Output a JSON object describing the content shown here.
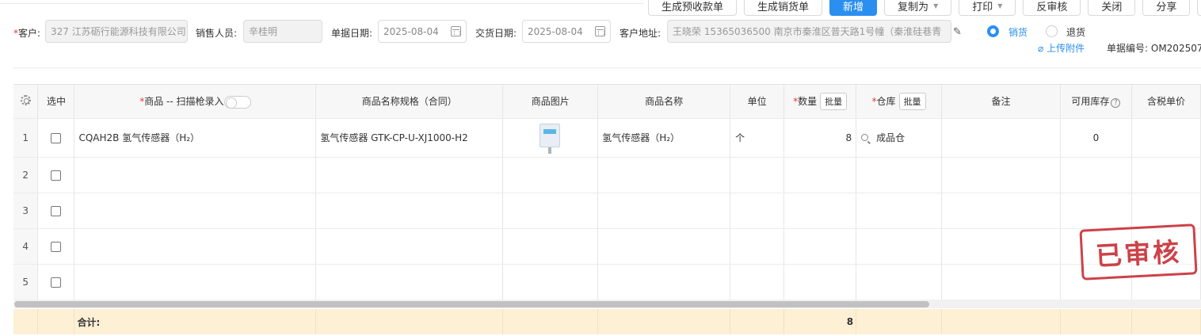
{
  "toolbar": {
    "gen_prepay_label": "生成预收款单",
    "gen_sales_label": "生成销货单",
    "new_label": "新增",
    "copy_label": "复制为",
    "print_label": "打印",
    "unaudit_label": "反审核",
    "close_label": "关闭",
    "share_label": "分享"
  },
  "form": {
    "customer_label": "客户:",
    "customer_value": "327 江苏砺行能源科技有限公司",
    "salesperson_label": "销售人员:",
    "salesperson_value": "辛桂明",
    "doc_date_label": "单据日期:",
    "doc_date_value": "2025-08-04",
    "delivery_date_label": "交货日期:",
    "delivery_date_value": "2025-08-04",
    "address_label": "客户地址:",
    "address_value": "王晓荣 15365036500 南京市秦淮区普天路1号幢（秦淮硅巷青",
    "radio_sale": "销货",
    "radio_return": "退货",
    "radio_selected": "sale",
    "upload_label": "上传附件",
    "doc_no_label": "单据编号:",
    "doc_no_value": "OM202507"
  },
  "table": {
    "headers": {
      "select": "选中",
      "product": "商品 -- 扫描枪录入",
      "spec": "商品名称规格（合同）",
      "image": "商品图片",
      "name": "商品名称",
      "unit": "单位",
      "qty": "数量",
      "warehouse": "仓库",
      "remark": "备注",
      "stock": "可用库存",
      "price": "含税单价",
      "batch": "批量"
    },
    "rows": [
      {
        "idx": "1",
        "product": "CQAH2B 氢气传感器（H₂）",
        "spec": "氢气传感器 GTK-CP-U-XJ1000-H2",
        "name": "氢气传感器（H₂）",
        "unit": "个",
        "qty": "8",
        "warehouse": "成品仓",
        "remark": "",
        "stock": "0",
        "price": ""
      },
      {
        "idx": "2",
        "product": "",
        "spec": "",
        "name": "",
        "unit": "",
        "qty": "",
        "warehouse": "",
        "remark": "",
        "stock": "",
        "price": ""
      },
      {
        "idx": "3",
        "product": "",
        "spec": "",
        "name": "",
        "unit": "",
        "qty": "",
        "warehouse": "",
        "remark": "",
        "stock": "",
        "price": ""
      },
      {
        "idx": "4",
        "product": "",
        "spec": "",
        "name": "",
        "unit": "",
        "qty": "",
        "warehouse": "",
        "remark": "",
        "stock": "",
        "price": ""
      },
      {
        "idx": "5",
        "product": "",
        "spec": "",
        "name": "",
        "unit": "",
        "qty": "",
        "warehouse": "",
        "remark": "",
        "stock": "",
        "price": ""
      }
    ],
    "total_label": "合计:",
    "total_qty": "8"
  },
  "stamp_text": "已审核",
  "colors": {
    "primary": "#2b8ff0",
    "stamp": "#c8323a",
    "total_bg": "#fdf0d5",
    "required": "#e4393c"
  }
}
